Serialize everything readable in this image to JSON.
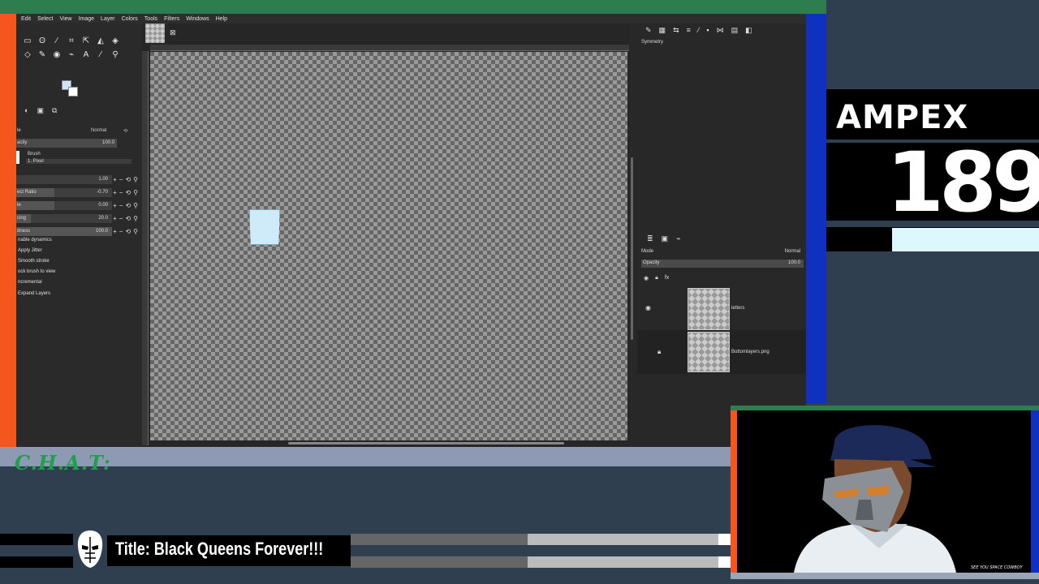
{
  "menu": [
    "Edit",
    "Select",
    "View",
    "Image",
    "Layer",
    "Colors",
    "Tools",
    "Filters",
    "Windows",
    "Help"
  ],
  "tool_options": {
    "mode_label": "Normal",
    "opacity_label": "acity",
    "opacity_value": "100.0",
    "brush_label": "Brush",
    "brush_name": "1. Pixel",
    "rows": [
      {
        "label": "",
        "value": "1.00",
        "fill": 0
      },
      {
        "label": "ect Ratio",
        "value": "-0.70",
        "fill": 0.4
      },
      {
        "label": "le",
        "value": "0.00",
        "fill": 0.4
      },
      {
        "label": "cing",
        "value": "20.0",
        "fill": 0.15
      },
      {
        "label": "dness",
        "value": "100.0",
        "fill": 1.0
      }
    ],
    "options": [
      "nable dynamics",
      "Apply Jitter",
      "Smooth stroke",
      "ock brush to view",
      "ncremental",
      "Expand Layers"
    ]
  },
  "dock": {
    "symmetry_label": "Symmetry",
    "mode_label": "Mode",
    "mode_value": "Normal",
    "opacity_label": "Opacity",
    "opacity_value": "100.0",
    "layers": [
      {
        "name": "letters"
      },
      {
        "name": "Bottomlayers.png"
      }
    ]
  },
  "overlay": {
    "brand": "AMPEX",
    "episode": "189",
    "progress": 0.31,
    "chat_label": "C.H.A.T:",
    "stream_title": "Title: Black Queens Forever!!!",
    "cam_tag": "SEE YOU SPACE COWBOY"
  },
  "colors": {
    "accent_green": "#2e7d4f",
    "accent_orange": "#f4561e",
    "accent_blue": "#1030c0",
    "fg_color": "#cfe4f8"
  }
}
